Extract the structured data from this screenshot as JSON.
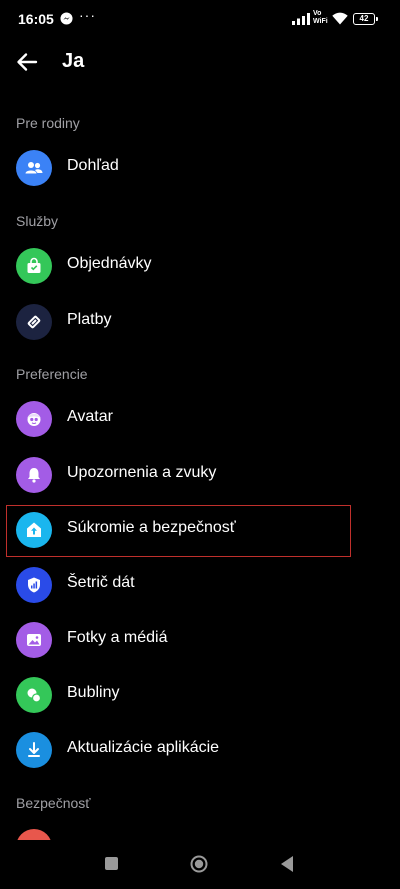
{
  "status_bar": {
    "time": "16:05",
    "dots": "···",
    "vowifi_line1": "Vo",
    "vowifi_line2": "WiFi",
    "battery": "42"
  },
  "header": {
    "title": "Ja"
  },
  "sections": {
    "family": "Pre rodiny",
    "services": "Služby",
    "preferences": "Preferencie",
    "security": "Bezpečnosť"
  },
  "items": {
    "supervision": {
      "label": "Dohľad",
      "color": "#3b82f6",
      "icon": "people-icon"
    },
    "orders": {
      "label": "Objednávky",
      "color": "#34c759",
      "icon": "shopping-bag-icon"
    },
    "payments": {
      "label": "Platby",
      "color": "#1c2340",
      "icon": "tag-icon"
    },
    "avatar": {
      "label": "Avatar",
      "color": "#a35ce6",
      "icon": "avatar-face-icon"
    },
    "notifications": {
      "label": "Upozornenia a zvuky",
      "color": "#a35ce6",
      "icon": "bell-icon"
    },
    "privacy": {
      "label": "Súkromie a bezpečnosť",
      "color": "#1ab6ee",
      "icon": "house-upload-icon"
    },
    "data_saver": {
      "label": "Šetrič dát",
      "color": "#2a4be8",
      "icon": "shield-signal-icon"
    },
    "photos": {
      "label": "Fotky a médiá",
      "color": "#a35ce6",
      "icon": "image-icon"
    },
    "bubbles": {
      "label": "Bubliny",
      "color": "#34c759",
      "icon": "bubbles-icon"
    },
    "updates": {
      "label": "Aktualizácie aplikácie",
      "color": "#1a8fe0",
      "icon": "download-icon"
    }
  }
}
